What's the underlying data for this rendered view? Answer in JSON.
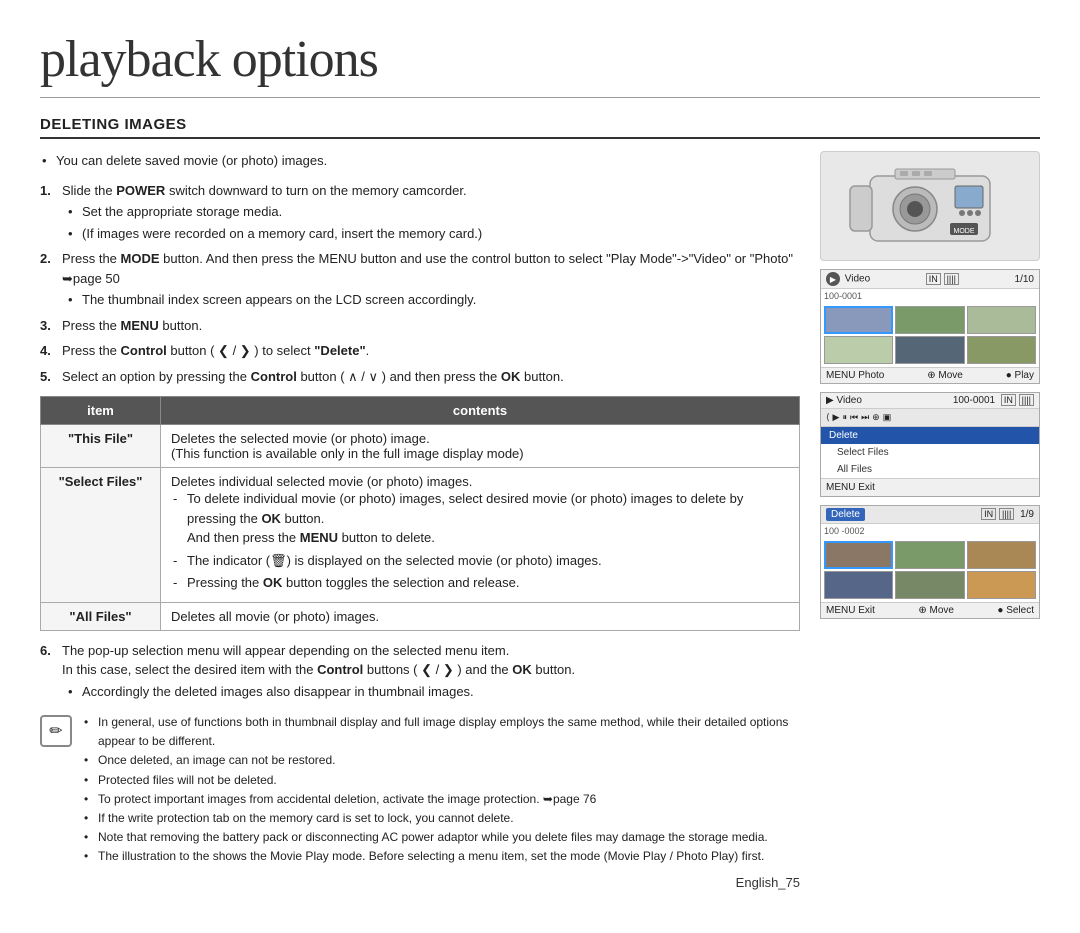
{
  "page": {
    "title": "playback options",
    "section": "DELETING IMAGES",
    "page_number": "English_75"
  },
  "intro_bullet": "You can delete saved movie (or photo) images.",
  "steps": [
    {
      "num": "1",
      "text_parts": [
        "Slide the ",
        "POWER",
        " switch downward to turn on the memory camcorder."
      ],
      "sub_bullets": [
        "Set the appropriate storage media.",
        "(If images were recorded on a memory card, insert the memory card.)"
      ]
    },
    {
      "num": "2",
      "text_parts": [
        "Press the ",
        "MODE",
        " button. And then press the MENU button and use the control button to select \"Play Mode\"->\"Video\" or \"Photo\" ➥page 50"
      ],
      "sub_bullets": [
        "The thumbnail index screen appears on the LCD screen accordingly."
      ]
    },
    {
      "num": "3",
      "text_parts": [
        "Press the ",
        "MENU",
        " button."
      ]
    },
    {
      "num": "4",
      "text_parts": [
        "Press the ",
        "Control",
        " button ( ❮ / ❯ ) to select ",
        "\"Delete\"",
        "."
      ]
    },
    {
      "num": "5",
      "text_parts": [
        "Select an option by pressing the ",
        "Control",
        " button ( ∧ / ∨ ) and then press the ",
        "OK",
        " button."
      ]
    }
  ],
  "table": {
    "headers": [
      "item",
      "contents"
    ],
    "rows": [
      {
        "item": "\"This File\"",
        "contents_lines": [
          "Deletes the selected movie (or photo) image.",
          "(This function is available only in the full image display mode)"
        ]
      },
      {
        "item": "\"Select Files\"",
        "contents_lines": [
          "Deletes individual selected movie (or photo) images.",
          "- To delete individual movie (or photo) images, select desired movie",
          "  (or photo) images to delete by pressing the OK button.",
          "  And then press the MENU button to delete.",
          "- The indicator (🗑) is displayed on the selected movie (or photo) images.",
          "- Pressing the OK button toggles the selection and release."
        ]
      },
      {
        "item": "\"All Files\"",
        "contents_lines": [
          "Deletes all movie (or photo) images."
        ]
      }
    ]
  },
  "step6": {
    "text": "The pop-up selection menu will appear depending on the selected menu item.",
    "text2": "In this case, select the desired item with the Control buttons ( ❮ / ❯ ) and the OK button.",
    "sub_bullet": "Accordingly the deleted images also disappear in thumbnail images."
  },
  "notes": [
    "In general, use of functions both in thumbnail display and full image display employs the same method, while their detailed options appear to be different.",
    "Once deleted, an image can not be restored.",
    "Protected files will not be deleted.",
    "To protect important images from accidental deletion, activate the image protection. ➥page 76",
    "If the write protection tab on the memory card is set to lock, you cannot delete.",
    "Note that removing the battery pack or disconnecting AC power adaptor while you delete files may damage the storage media.",
    "The illustration to the shows the Movie Play mode. Before selecting a menu item, set the mode (Movie Play / Photo Play) first."
  ],
  "right_panel": {
    "screen1": {
      "label": "Video",
      "counter": "1/10",
      "code": "100-0001",
      "footer_left": "MENU Photo",
      "footer_mid": "⊕ Move",
      "footer_right": "● Play"
    },
    "screen2": {
      "label": "Video",
      "code": "100-0001",
      "menu_items": [
        "Delete",
        "Select Files",
        "All Files"
      ],
      "highlighted": "Delete",
      "footer": "MENU Exit"
    },
    "screen3": {
      "label": "Delete",
      "code": "100 -0002",
      "counter": "1/9",
      "footer_left": "MENU Exit",
      "footer_mid": "⊕ Move",
      "footer_right": "● Select"
    }
  }
}
